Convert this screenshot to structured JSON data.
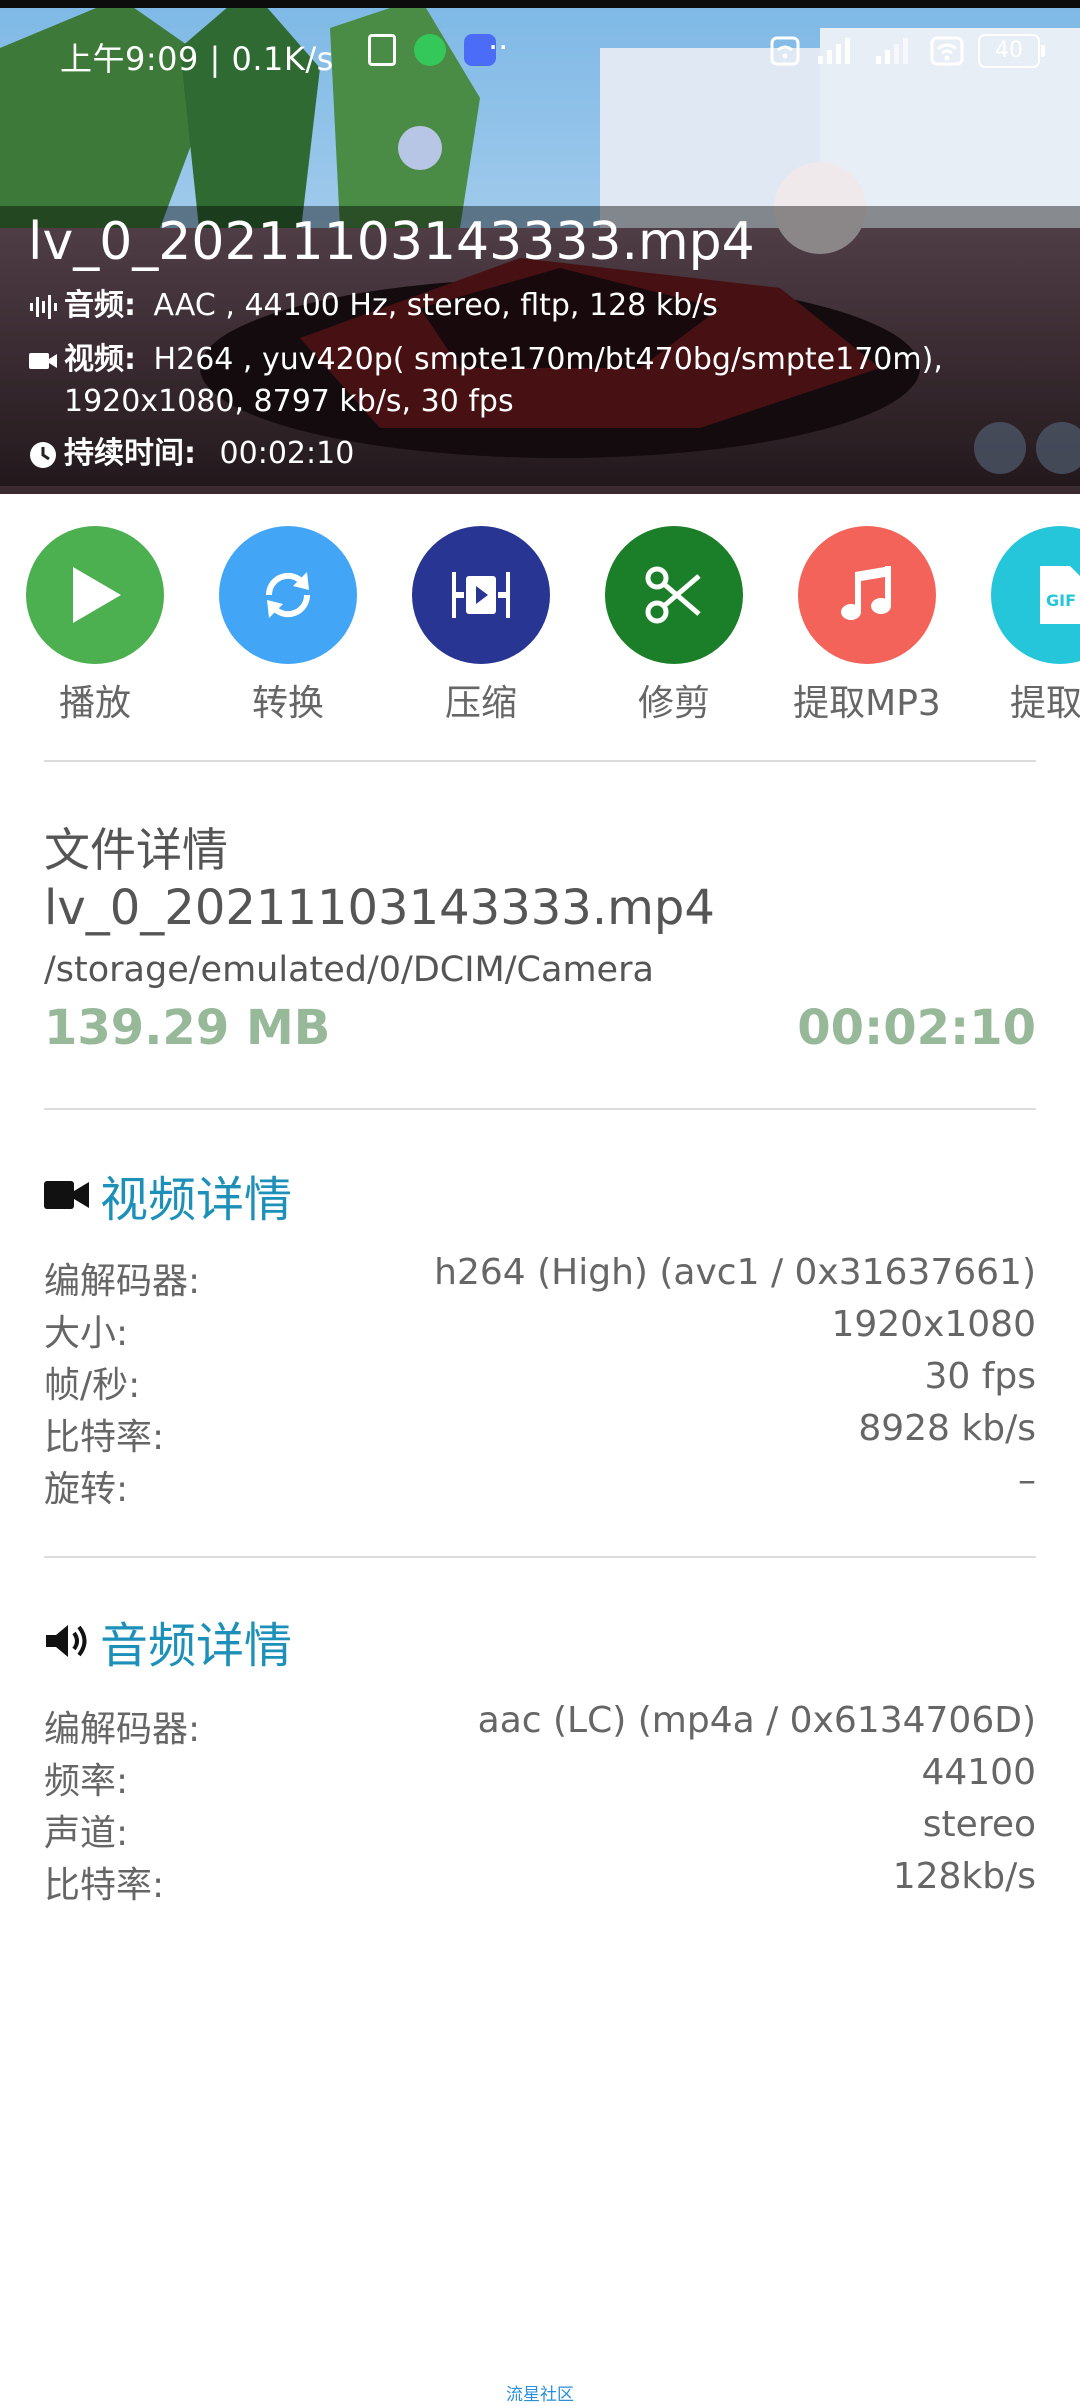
{
  "status_bar": {
    "time": "上午9:09 | 0.1K/s",
    "battery": "40"
  },
  "header": {
    "file_name": "lv_0_20211103143333.mp4",
    "audio_label": "音频:",
    "audio_value": "AAC , 44100 Hz, stereo, fltp, 128 kb/s",
    "video_label": "视频:",
    "video_value_line1": "H264 , yuv420p( smpte170m/bt470bg/smpte170m),",
    "video_value_line2": "1920x1080, 8797 kb/s, 30 fps",
    "duration_label": "持续时间:",
    "duration_value": "00:02:10"
  },
  "actions": [
    {
      "label": "播放",
      "color": "#4caf50",
      "icon": "play-icon"
    },
    {
      "label": "转换",
      "color": "#42a5f5",
      "icon": "convert-icon"
    },
    {
      "label": "压缩",
      "color": "#283593",
      "icon": "compress-icon"
    },
    {
      "label": "修剪",
      "color": "#1b7f2a",
      "icon": "scissors-icon"
    },
    {
      "label": "提取MP3",
      "color": "#f4635a",
      "icon": "music-note-icon"
    },
    {
      "label": "提取G",
      "color": "#26c6da",
      "icon": "gif-icon"
    }
  ],
  "file_details": {
    "title": "文件详情",
    "name": "lv_0_20211103143333.mp4",
    "path": "/storage/emulated/0/DCIM/Camera",
    "size": "139.29 MB",
    "duration": "00:02:10"
  },
  "video_details": {
    "title": "视频详情",
    "rows": [
      {
        "k": "编解码器:",
        "v": "h264 (High) (avc1 / 0x31637661)"
      },
      {
        "k": "大小:",
        "v": "1920x1080"
      },
      {
        "k": "帧/秒:",
        "v": "30 fps"
      },
      {
        "k": "比特率:",
        "v": "8928 kb/s"
      },
      {
        "k": "旋转:",
        "v": "–"
      }
    ]
  },
  "audio_details": {
    "title": "音频详情",
    "rows": [
      {
        "k": "编解码器:",
        "v": "aac (LC) (mp4a / 0x6134706D)"
      },
      {
        "k": "频率:",
        "v": "44100"
      },
      {
        "k": "声道:",
        "v": "stereo"
      },
      {
        "k": "比特率:",
        "v": "128kb/s"
      }
    ]
  },
  "footer": {
    "watermark": "流星社区"
  }
}
